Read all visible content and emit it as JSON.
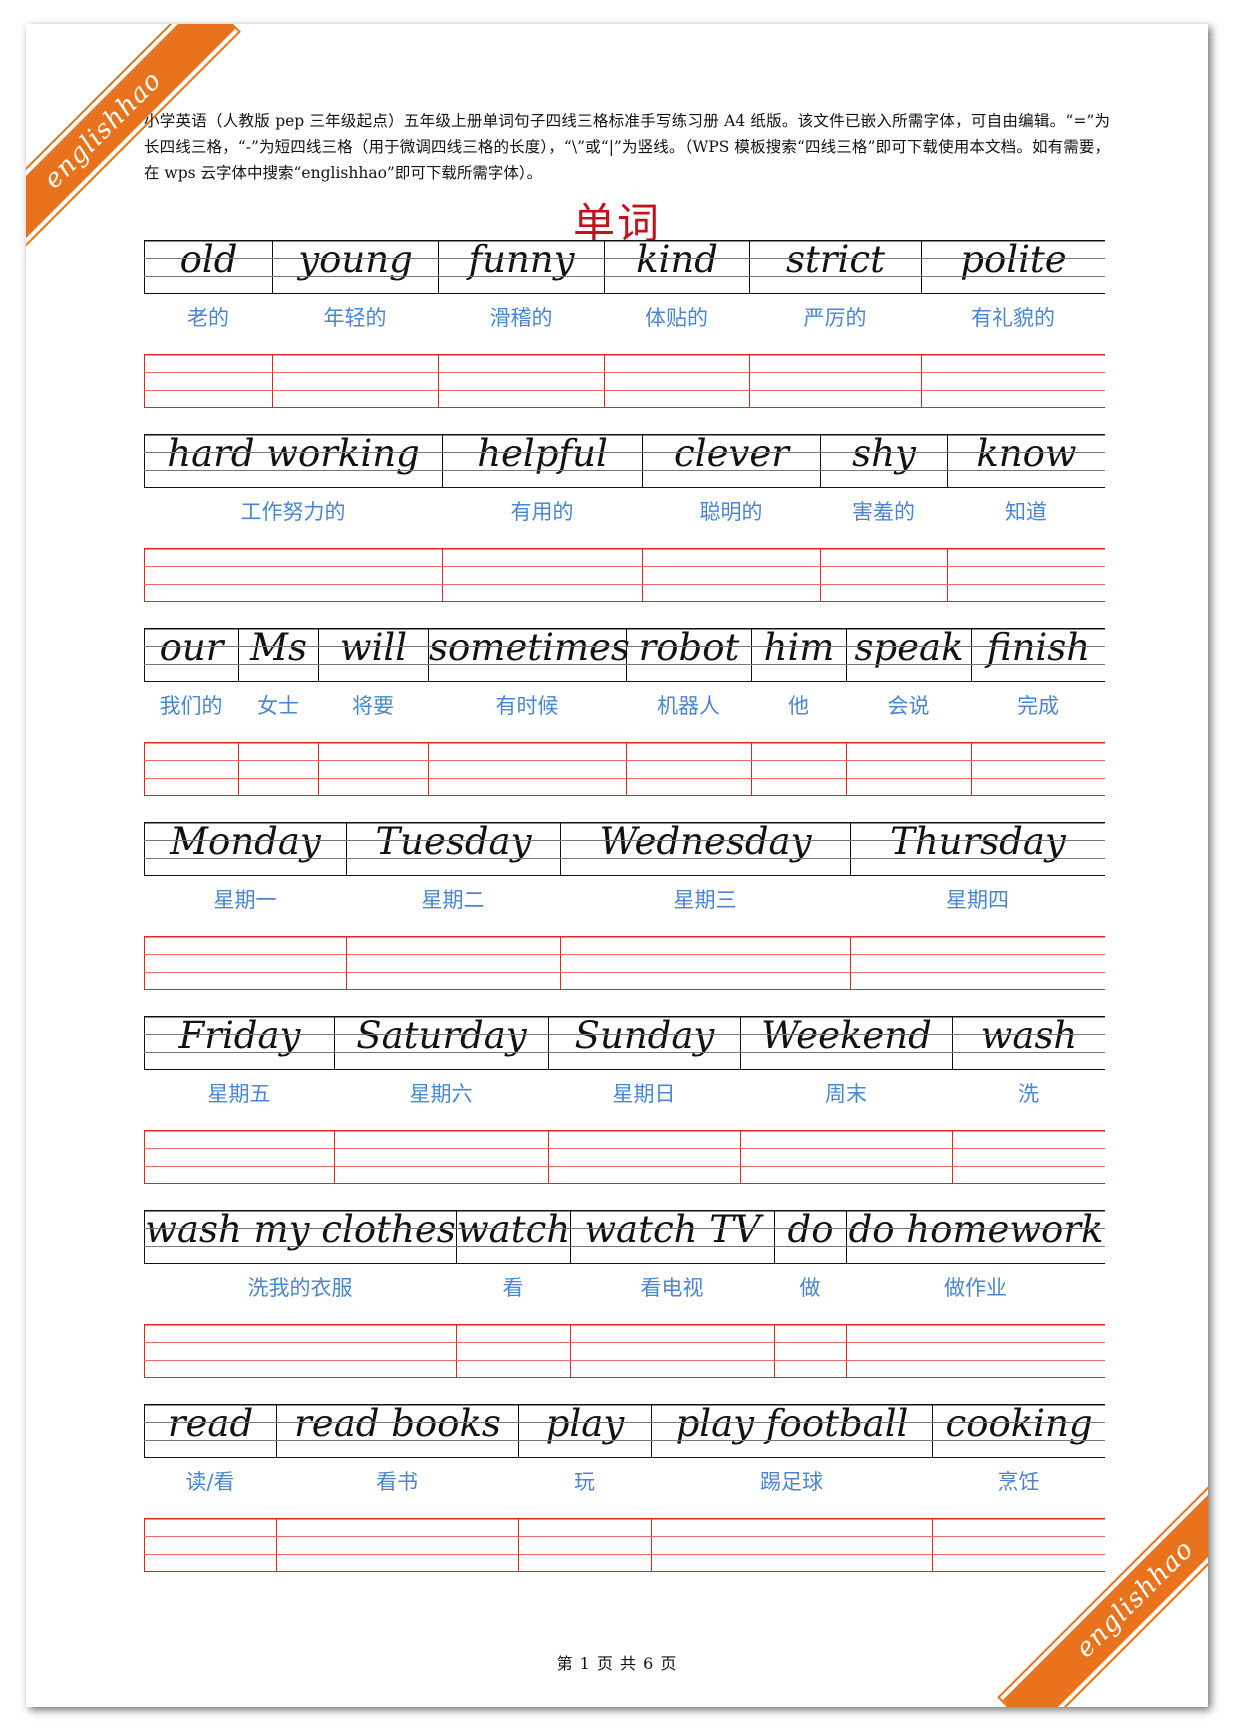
{
  "watermark": "englishhao",
  "intro": "小学英语（人教版 pep 三年级起点）五年级上册单词句子四线三格标准手写练习册 A4 纸版。该文件已嵌入所需字体，可自由编辑。“=”为长四线三格，“-”为短四线三格（用于微调四线三格的长度），“\\”或“|”为竖线。（WPS 模板搜索“四线三格”即可下载使用本文档。如有需要，在 wps 云字体中搜索“englishhao”即可下载所需字体）。",
  "title": "单词",
  "rows": [
    {
      "words": [
        {
          "en": "old",
          "zh": "老的"
        },
        {
          "en": "young",
          "zh": "年轻的"
        },
        {
          "en": "funny",
          "zh": "滑稽的"
        },
        {
          "en": "kind",
          "zh": "体贴的"
        },
        {
          "en": "strict",
          "zh": "严厉的"
        },
        {
          "en": "polite",
          "zh": "有礼貌的"
        }
      ]
    },
    {
      "words": [
        {
          "en": "hard working",
          "zh": "工作努力的"
        },
        {
          "en": "helpful",
          "zh": "有用的"
        },
        {
          "en": "clever",
          "zh": "聪明的"
        },
        {
          "en": "shy",
          "zh": "害羞的"
        },
        {
          "en": "know",
          "zh": "知道"
        }
      ]
    },
    {
      "words": [
        {
          "en": "our",
          "zh": "我们的"
        },
        {
          "en": "Ms",
          "zh": "女士"
        },
        {
          "en": "will",
          "zh": "将要"
        },
        {
          "en": "sometimes",
          "zh": "有时候"
        },
        {
          "en": "robot",
          "zh": "机器人"
        },
        {
          "en": "him",
          "zh": "他"
        },
        {
          "en": "speak",
          "zh": "会说"
        },
        {
          "en": "finish",
          "zh": "完成"
        }
      ]
    },
    {
      "words": [
        {
          "en": "Monday",
          "zh": "星期一"
        },
        {
          "en": "Tuesday",
          "zh": "星期二"
        },
        {
          "en": "Wednesday",
          "zh": "星期三"
        },
        {
          "en": "Thursday",
          "zh": "星期四"
        }
      ]
    },
    {
      "words": [
        {
          "en": "Friday",
          "zh": "星期五"
        },
        {
          "en": "Saturday",
          "zh": "星期六"
        },
        {
          "en": "Sunday",
          "zh": "星期日"
        },
        {
          "en": "Weekend",
          "zh": "周末"
        },
        {
          "en": "wash",
          "zh": "洗"
        }
      ]
    },
    {
      "words": [
        {
          "en": "wash my clothes",
          "zh": "洗我的衣服"
        },
        {
          "en": "watch",
          "zh": "看"
        },
        {
          "en": "watch TV",
          "zh": "看电视"
        },
        {
          "en": "do",
          "zh": "做"
        },
        {
          "en": "do homework",
          "zh": "做作业"
        }
      ]
    },
    {
      "words": [
        {
          "en": "read",
          "zh": "读/看"
        },
        {
          "en": "read books",
          "zh": "看书"
        },
        {
          "en": "play",
          "zh": "玩"
        },
        {
          "en": "play football",
          "zh": "踢足球"
        },
        {
          "en": "cooking",
          "zh": "烹饪"
        }
      ]
    }
  ],
  "footer": {
    "prefix": "第",
    "current": "1",
    "mid": "页 共",
    "total": "6",
    "suffix": "页"
  },
  "colors": {
    "title": "#c0141c",
    "translation": "#4a86cf",
    "practice_lines": "#e22424",
    "ribbon": "#e8731c"
  }
}
